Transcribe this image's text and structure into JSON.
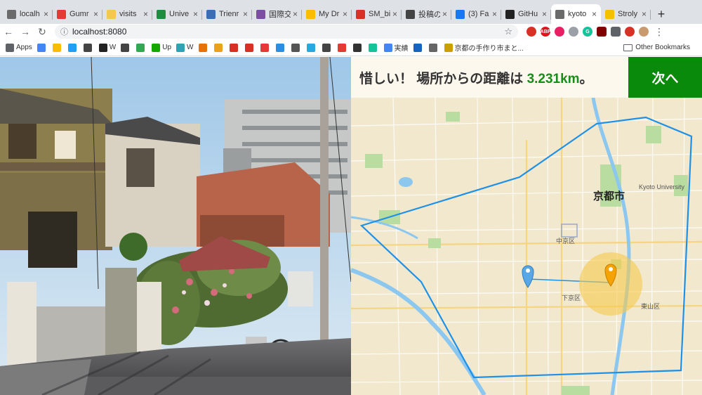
{
  "browser": {
    "tabs": [
      {
        "title": "localh",
        "color": "#6b6b6b"
      },
      {
        "title": "Gumr",
        "color": "#e53935"
      },
      {
        "title": "visits",
        "color": "#f2c94c"
      },
      {
        "title": "Unive",
        "color": "#1e8e3e"
      },
      {
        "title": "Trienr",
        "color": "#3b6db3"
      },
      {
        "title": "国際交",
        "color": "#7b4ea3"
      },
      {
        "title": "My Dr",
        "color": "#fbbc04"
      },
      {
        "title": "SM_bi",
        "color": "#d93025"
      },
      {
        "title": "投稿の",
        "color": "#444444"
      },
      {
        "title": "(3) Fa",
        "color": "#1877f2"
      },
      {
        "title": "GitHu",
        "color": "#222222"
      },
      {
        "title": "kyoto",
        "color": "#6b6b6b"
      },
      {
        "title": "Stroly",
        "color": "#f2c200"
      }
    ],
    "address": "localhost:8080",
    "bookmarks": [
      {
        "label": "Apps",
        "color": "#5f6368"
      },
      {
        "label": "",
        "color": "#4285f4"
      },
      {
        "label": "",
        "color": "#fbbc04"
      },
      {
        "label": "",
        "color": "#1da1f2"
      },
      {
        "label": "",
        "color": "#444444"
      },
      {
        "label": "W",
        "color": "#222222"
      },
      {
        "label": "",
        "color": "#444444"
      },
      {
        "label": "",
        "color": "#34a853"
      },
      {
        "label": "Up",
        "color": "#14a800"
      },
      {
        "label": "W",
        "color": "#2ea3b3"
      },
      {
        "label": "",
        "color": "#e8710a"
      },
      {
        "label": "",
        "color": "#e8a317"
      },
      {
        "label": "",
        "color": "#d93025"
      },
      {
        "label": "",
        "color": "#d93025"
      },
      {
        "label": "",
        "color": "#e53935"
      },
      {
        "label": "",
        "color": "#2b8ede"
      },
      {
        "label": "",
        "color": "#555555"
      },
      {
        "label": "",
        "color": "#26a8e0"
      },
      {
        "label": "",
        "color": "#444444"
      },
      {
        "label": "",
        "color": "#e53935"
      },
      {
        "label": "",
        "color": "#333333"
      },
      {
        "label": "",
        "color": "#15c39a"
      },
      {
        "label": "実績",
        "color": "#4285f4"
      },
      {
        "label": "",
        "color": "#1565c0"
      },
      {
        "label": "",
        "color": "#666666"
      },
      {
        "label": "京都の手作り市まと...",
        "color": "#c8a000"
      }
    ],
    "other_bookmarks": "Other Bookmarks"
  },
  "game": {
    "result_prefix": "惜しい！ 場所からの距離は",
    "distance": "3.231km",
    "result_suffix": "。",
    "next_button": "次へ",
    "map_labels": {
      "city": "京都市",
      "university": "Kyoto University",
      "nakagyo": "中京区",
      "shimogyo": "下京区",
      "higashiyama": "東山区"
    },
    "colors": {
      "accent": "#0a8a0a",
      "guess_marker": "#5aa7e6",
      "answer_marker": "#f5a300",
      "boundary": "#1e90e8"
    }
  }
}
